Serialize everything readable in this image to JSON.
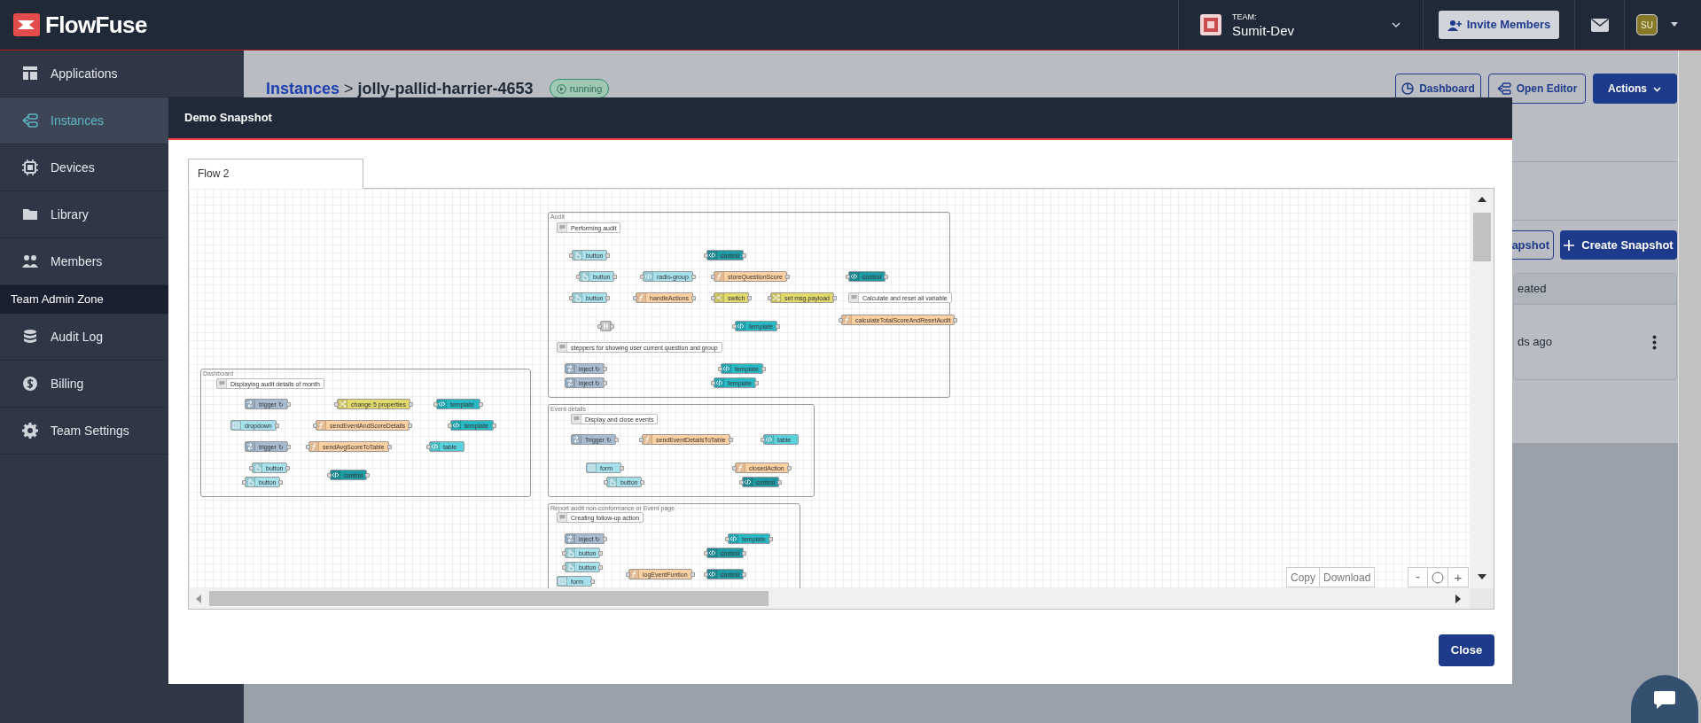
{
  "header": {
    "logo": "FlowFuse",
    "team_label": "TEAM:",
    "team_name": "Sumit-Dev",
    "invite_button": "Invite Members",
    "avatar": "SU"
  },
  "sidebar": {
    "items": [
      {
        "label": "Applications",
        "selected": false
      },
      {
        "label": "Instances",
        "selected": true
      },
      {
        "label": "Devices",
        "selected": false
      },
      {
        "label": "Library",
        "selected": false
      },
      {
        "label": "Members",
        "selected": false
      }
    ],
    "section": "Team Admin Zone",
    "admin_items": [
      {
        "label": "Audit Log",
        "selected": false
      },
      {
        "label": "Billing",
        "selected": false
      },
      {
        "label": "Team Settings",
        "selected": false
      }
    ]
  },
  "page": {
    "breadcrumb": {
      "parent": "Instances",
      "separator": ">",
      "current": "jolly-pallid-harrier-4653"
    },
    "status": "running",
    "buttons": [
      "Dashboard",
      "Open Editor",
      "Actions"
    ],
    "snapshot_button": "apshot",
    "create_button": "Create Snapshot",
    "column_header": "eated",
    "row_time": "ds ago"
  },
  "modal": {
    "title": "Demo Snapshot",
    "tabs": [
      {
        "label": "Flow 2",
        "selected": true
      }
    ],
    "flow_groups": [
      {
        "label": "Audit",
        "nodes": [
          {
            "kind": "comment",
            "label": "Performing audit"
          },
          {
            "kind": "button",
            "label": "button"
          },
          {
            "kind": "control",
            "label": "control"
          },
          {
            "kind": "button",
            "label": "button"
          },
          {
            "kind": "radio",
            "label": "radio-group"
          },
          {
            "kind": "function",
            "label": "storeQuestionScore"
          },
          {
            "kind": "control",
            "label": "control"
          },
          {
            "kind": "button",
            "label": "button"
          },
          {
            "kind": "function",
            "label": "handleActions"
          },
          {
            "kind": "switch",
            "label": "switch"
          },
          {
            "kind": "change",
            "label": "set msg.payload"
          },
          {
            "kind": "comment",
            "label": "Calculate and reset all variable"
          },
          {
            "kind": "function",
            "label": "calculateTotalScoreAndResetAudit"
          },
          {
            "kind": "link"
          },
          {
            "kind": "template",
            "label": "template"
          },
          {
            "kind": "comment",
            "label": "steppers for showing user current question and group"
          },
          {
            "kind": "inject",
            "label": "inject ↻"
          },
          {
            "kind": "template",
            "label": "template"
          },
          {
            "kind": "inject",
            "label": "inject ↻"
          },
          {
            "kind": "template",
            "label": "template"
          }
        ]
      },
      {
        "label": "Dashboard",
        "nodes": [
          {
            "kind": "comment",
            "label": "Displaying audit details of month"
          },
          {
            "kind": "inject",
            "label": "trigger ↻"
          },
          {
            "kind": "change",
            "label": "change 5 properties"
          },
          {
            "kind": "template",
            "label": "template"
          },
          {
            "kind": "dropdown",
            "label": "dropdown"
          },
          {
            "kind": "function",
            "label": "sendEventAndScoreDetails"
          },
          {
            "kind": "template",
            "label": "template"
          },
          {
            "kind": "inject",
            "label": "trigger ↻"
          },
          {
            "kind": "function",
            "label": "sendAvgScoreToTable"
          },
          {
            "kind": "table",
            "label": "table"
          },
          {
            "kind": "button",
            "label": "button"
          },
          {
            "kind": "button",
            "label": "button"
          },
          {
            "kind": "control",
            "label": "control"
          }
        ]
      },
      {
        "label": "Event details",
        "nodes": [
          {
            "kind": "comment",
            "label": "Display and close events"
          },
          {
            "kind": "inject",
            "label": "Trigger ↻"
          },
          {
            "kind": "function",
            "label": "sendEventDetailsToTable"
          },
          {
            "kind": "table",
            "label": "table"
          },
          {
            "kind": "form",
            "label": "form"
          },
          {
            "kind": "function",
            "label": "closedAction"
          },
          {
            "kind": "button",
            "label": "button"
          },
          {
            "kind": "control",
            "label": "control"
          }
        ]
      },
      {
        "label": "Report audit non-conformance or Event page",
        "nodes": [
          {
            "kind": "comment",
            "label": "Creating follow-up action"
          },
          {
            "kind": "inject",
            "label": "inject ↻"
          },
          {
            "kind": "template",
            "label": "template"
          },
          {
            "kind": "button",
            "label": "button"
          },
          {
            "kind": "control",
            "label": "control"
          },
          {
            "kind": "button",
            "label": "button"
          },
          {
            "kind": "function",
            "label": "logEventFuntion"
          },
          {
            "kind": "control",
            "label": "control"
          },
          {
            "kind": "form",
            "label": "form"
          }
        ]
      }
    ],
    "canvas_buttons": [
      "Copy",
      "Download"
    ],
    "zoom_out": "-",
    "zoom_in": "+",
    "close_button": "Close"
  }
}
